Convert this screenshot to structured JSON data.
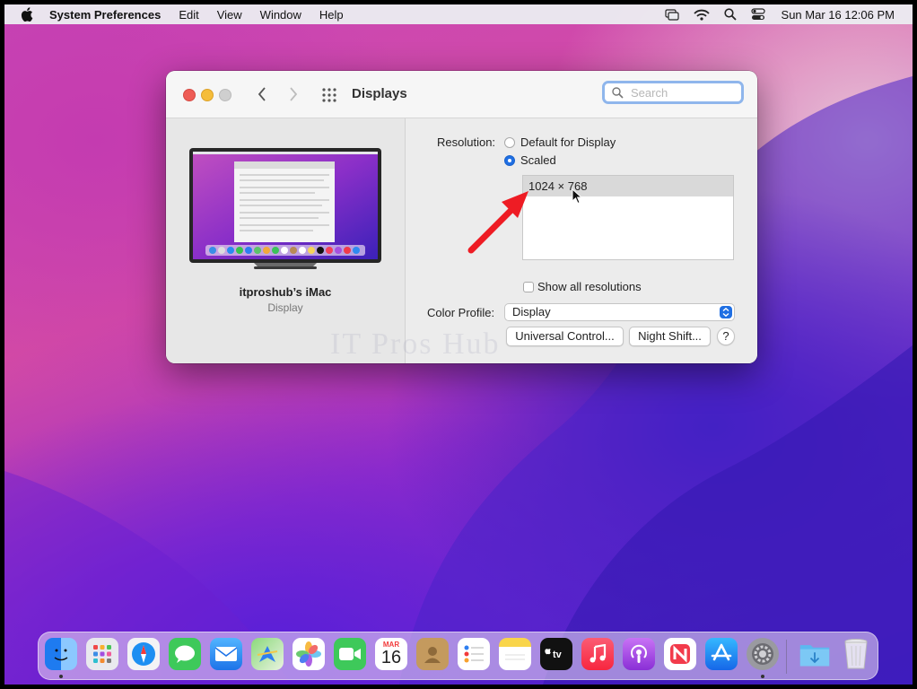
{
  "menubar": {
    "app": "System Preferences",
    "menus": [
      "Edit",
      "View",
      "Window",
      "Help"
    ],
    "status_icons": [
      "screen-mirror-icon",
      "wifi-icon",
      "spotlight-search-icon",
      "control-center-icon"
    ],
    "clock": "Sun Mar 16  12:06 PM"
  },
  "window": {
    "title": "Displays",
    "search_placeholder": "Search",
    "display_name": "itproshub’s iMac",
    "display_type": "Display",
    "resolution": {
      "label": "Resolution:",
      "options": [
        {
          "label": "Default for Display",
          "selected": false
        },
        {
          "label": "Scaled",
          "selected": true
        }
      ],
      "list": [
        "1024 × 768"
      ]
    },
    "show_all": {
      "label": "Show all resolutions",
      "checked": false
    },
    "color_profile": {
      "label": "Color Profile:",
      "value": "Display"
    },
    "buttons": {
      "universal": "Universal Control...",
      "night_shift": "Night Shift...",
      "help": "?"
    }
  },
  "watermark": "IT Pros Hub",
  "calendar": {
    "month": "MAR",
    "day": "16"
  },
  "dock": {
    "icons": [
      "finder-icon",
      "launchpad-icon",
      "safari-icon",
      "messages-icon",
      "mail-icon",
      "maps-icon",
      "photos-icon",
      "facetime-icon",
      "calendar-icon",
      "contacts-icon",
      "reminders-icon",
      "notes-icon",
      "apple-tv-icon",
      "music-icon",
      "podcasts-icon",
      "news-icon",
      "app-store-icon",
      "system-preferences-icon",
      "downloads-folder-icon",
      "trash-icon"
    ]
  },
  "colors": {
    "accent": "#1f6fe3",
    "close": "#ee5c55",
    "minimize": "#f5bd3a",
    "arrow": "#ee1c24"
  }
}
